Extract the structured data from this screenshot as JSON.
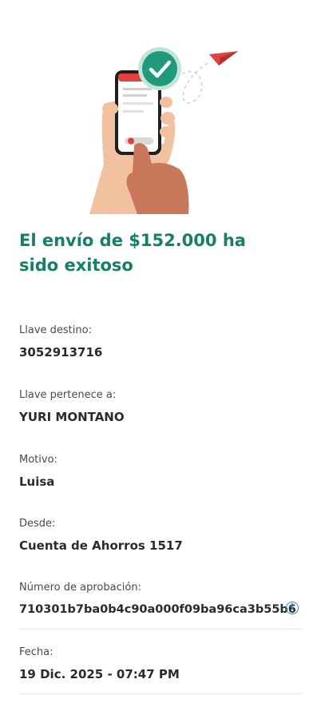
{
  "success": {
    "title": "El envío de $152.000 ha sido exitoso"
  },
  "colors": {
    "title_green": "#138068",
    "check_green": "#1f9a7a",
    "paper_plane_red": "#e5413b",
    "info_blue": "#2d8fd6"
  },
  "details": [
    {
      "label": "Llave destino:",
      "value": "3052913716"
    },
    {
      "label": "Llave pertenece a:",
      "value": "YURI MONTANO"
    },
    {
      "label": "Motivo:",
      "value": "Luisa"
    },
    {
      "label": "Desde:",
      "value": "Cuenta de Ahorros 1517"
    },
    {
      "label": "Número de aprobación:",
      "value": "710301b7ba0b4c90a000f09ba96ca3b55b6",
      "icon": "info-icon"
    },
    {
      "label": "Fecha:",
      "value": "19 Dic. 2025 - 07:47 PM"
    }
  ]
}
